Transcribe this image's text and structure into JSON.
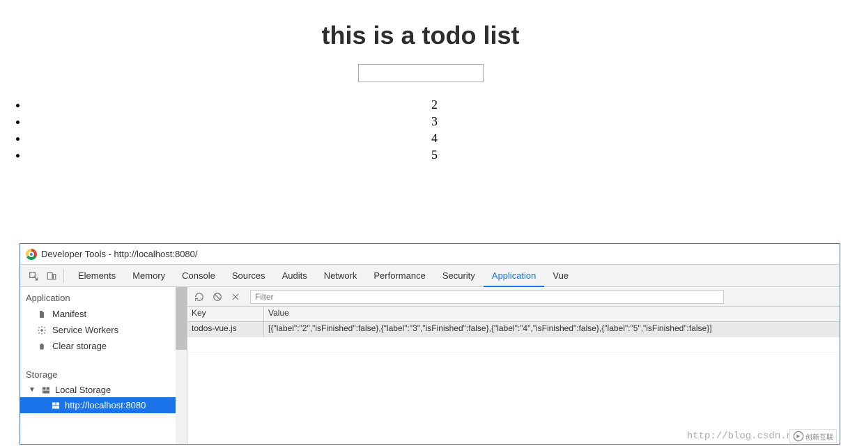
{
  "page": {
    "title": "this is a todo list",
    "input_value": "",
    "todos": [
      "2",
      "3",
      "4",
      "5"
    ]
  },
  "devtools": {
    "window_title": "Developer Tools - http://localhost:8080/",
    "tabs": [
      "Elements",
      "Memory",
      "Console",
      "Sources",
      "Audits",
      "Network",
      "Performance",
      "Security",
      "Application",
      "Vue"
    ],
    "active_tab": "Application",
    "sidebar": {
      "app_section": "Application",
      "app_items": [
        "Manifest",
        "Service Workers",
        "Clear storage"
      ],
      "storage_section": "Storage",
      "local_storage_label": "Local Storage",
      "local_storage_children": [
        "http://localhost:8080"
      ]
    },
    "toolbar": {
      "filter_placeholder": "Filter"
    },
    "table": {
      "headers": {
        "key": "Key",
        "value": "Value"
      },
      "rows": [
        {
          "key": "todos-vue.js",
          "value": "[{\"label\":\"2\",\"isFinished\":false},{\"label\":\"3\",\"isFinished\":false},{\"label\":\"4\",\"isFinished\":false},{\"label\":\"5\",\"isFinished\":false}]"
        }
      ]
    }
  },
  "watermark": "http://blog.csdn.n",
  "corner_badge": "创新互联"
}
